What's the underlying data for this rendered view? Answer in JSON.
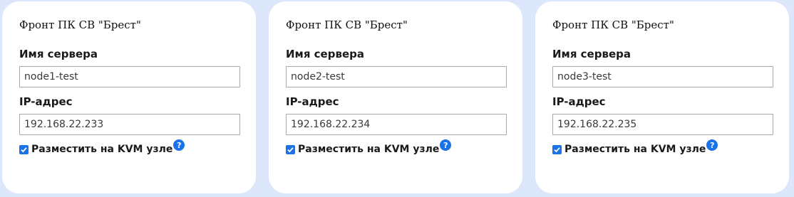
{
  "servers": [
    {
      "title": "Фронт ПК СВ \"Брест\"",
      "server_name_label": "Имя сервера",
      "server_name_value": "node1-test",
      "ip_label": "IP-адрес",
      "ip_value": "192.168.22.233",
      "kvm_label": "Разместить на KVM узле",
      "kvm_checked": true,
      "help_icon": "question-icon",
      "help_glyph": "?"
    },
    {
      "title": "Фронт ПК СВ \"Брест\"",
      "server_name_label": "Имя сервера",
      "server_name_value": "node2-test",
      "ip_label": "IP-адрес",
      "ip_value": "192.168.22.234",
      "kvm_label": "Разместить на KVM узле",
      "kvm_checked": true,
      "help_icon": "question-icon",
      "help_glyph": "?"
    },
    {
      "title": "Фронт ПК СВ \"Брест\"",
      "server_name_label": "Имя сервера",
      "server_name_value": "node3-test",
      "ip_label": "IP-адрес",
      "ip_value": "192.168.22.235",
      "kvm_label": "Разместить на KVM узле",
      "kvm_checked": true,
      "help_icon": "question-icon",
      "help_glyph": "?"
    }
  ],
  "colors": {
    "background": "#dde7fb",
    "card": "#ffffff",
    "accent": "#1a73e8",
    "input_border": "#a9a9a9"
  }
}
